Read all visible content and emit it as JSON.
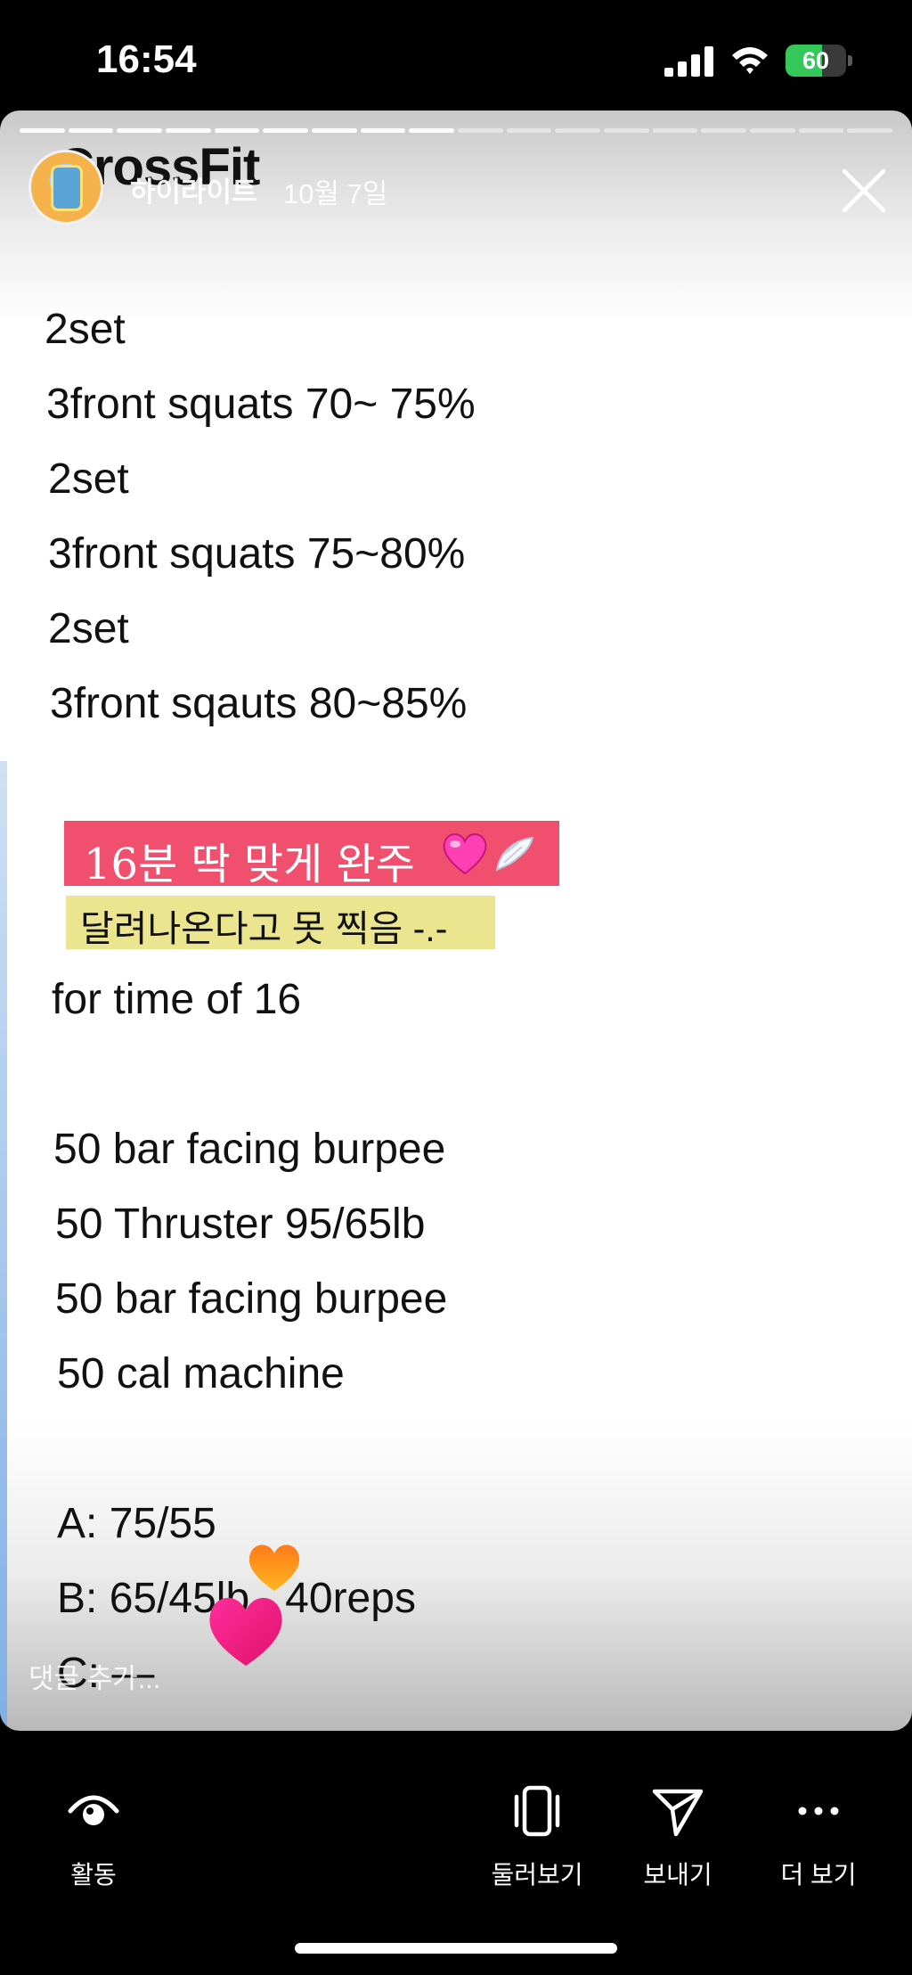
{
  "status_bar": {
    "time": "16:54",
    "battery": "60",
    "battery_fraction": 0.6,
    "battery_color": "#34c759"
  },
  "story": {
    "owner": "하이라이트",
    "date": "10월 7일",
    "background_title": "CrossFit",
    "progress_segments": 18,
    "progress_done": 9,
    "lines": [
      "2set",
      "3front squats 70~ 75%",
      "2set",
      "3front squats 75~80%",
      "2set",
      "3front sqauts 80~85%",
      "for time of 16",
      "50 bar facing burpee",
      "50 Thruster 95/65lb",
      "50 bar facing burpee",
      "50 cal machine",
      "A: 75/55",
      "B: 65/45lb , 40reps",
      "C: —"
    ],
    "highlight_pink": "16분 딱 맞게 완주",
    "highlight_pink_bg": "#f0506e",
    "highlight_yellow": "달려나온다고 못 찍음 -.-",
    "highlight_yellow_bg": "#ece58f",
    "comment_placeholder": "댓글 추가..."
  },
  "actions": [
    {
      "label": "활동",
      "icon": "activity-eye-icon"
    },
    {
      "label": "둘러보기",
      "icon": "browse-phone-icon"
    },
    {
      "label": "보내기",
      "icon": "send-paper-plane-icon"
    },
    {
      "label": "더 보기",
      "icon": "more-dots-icon"
    }
  ]
}
